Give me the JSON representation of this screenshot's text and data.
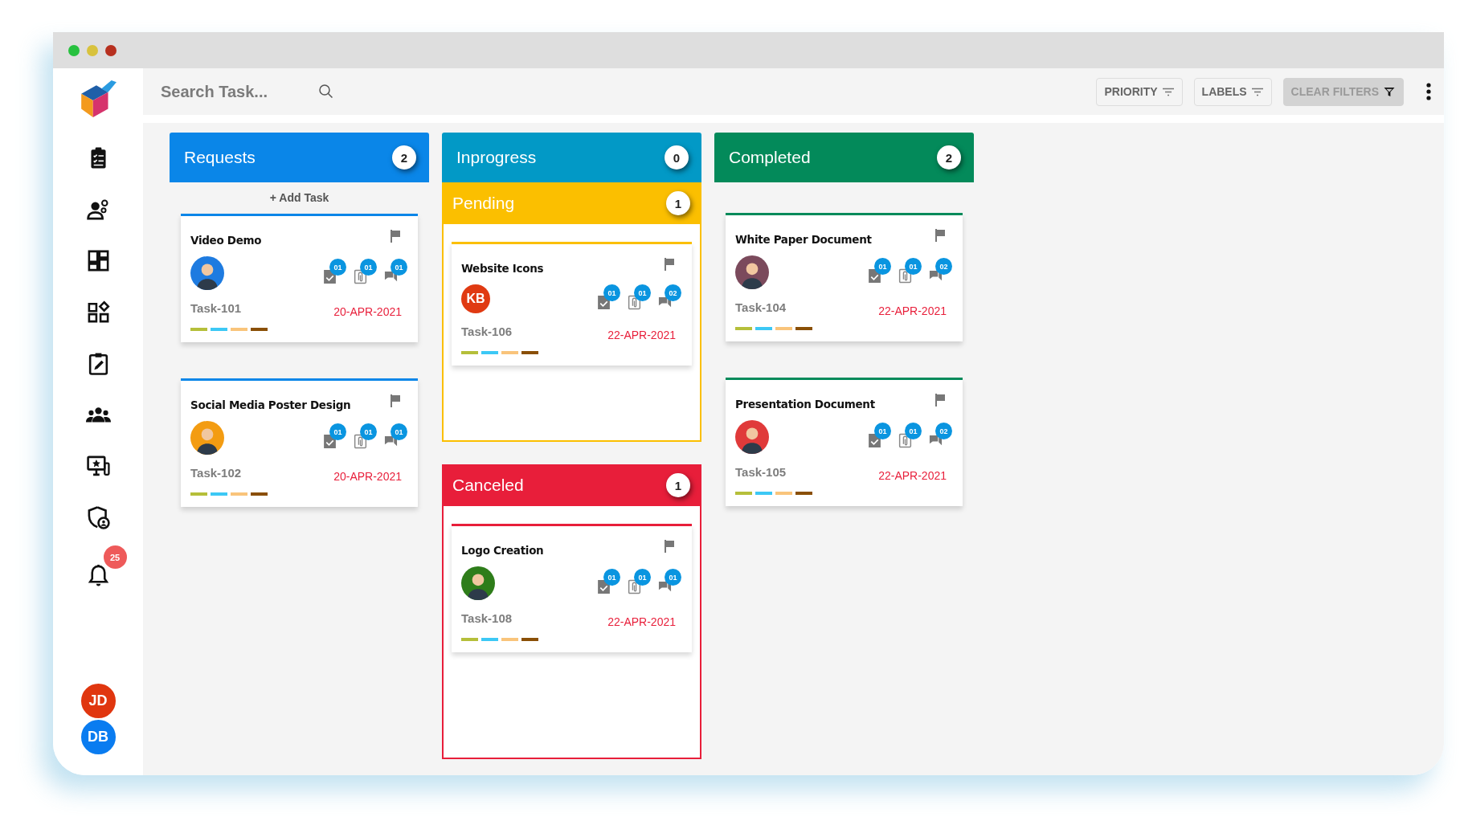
{
  "search": {
    "placeholder": "Search Task..."
  },
  "filters": [
    {
      "label": "PRIORITY",
      "kind": "sort",
      "disabled": false
    },
    {
      "label": "LABELS",
      "kind": "sort",
      "disabled": false
    },
    {
      "label": "CLEAR FILTERS",
      "kind": "funnel",
      "disabled": true
    }
  ],
  "notifications": {
    "count": "25"
  },
  "users": [
    {
      "initials": "JD",
      "color": "#e0360f"
    },
    {
      "initials": "DB",
      "color": "#0a7cf0"
    }
  ],
  "lanes": [
    {
      "title": "Requests",
      "count": "2",
      "color": "#0a86e8",
      "add_task": "+ Add Task",
      "cards": [
        {
          "title": "Video Demo",
          "avatar": {
            "kind": "photo",
            "color": "#1e7be0"
          },
          "checklist": "01",
          "attachments": "01",
          "comments": "01",
          "task_id": "Task-101",
          "date": "20-APR-2021",
          "labels": [
            {
              "color": "#b5bf3a"
            },
            {
              "color": "#3cc8f5"
            },
            {
              "color": "#f9c47b"
            },
            {
              "color": "#8a4f06"
            }
          ]
        },
        {
          "title": "Social Media Poster Design",
          "avatar": {
            "kind": "photo",
            "color": "#f39c12"
          },
          "checklist": "01",
          "attachments": "01",
          "comments": "01",
          "task_id": "Task-102",
          "date": "20-APR-2021",
          "labels": [
            {
              "color": "#b5bf3a"
            },
            {
              "color": "#3cc8f5"
            },
            {
              "color": "#f9c47b"
            },
            {
              "color": "#8a4f06"
            }
          ]
        }
      ]
    },
    {
      "title": "Inprogress",
      "count": "0",
      "color": "#0299c6",
      "sublanes": [
        {
          "title": "Pending",
          "count": "1",
          "color": "#fbbf00",
          "cards": [
            {
              "title": "Website Icons",
              "avatar": {
                "kind": "initials",
                "initials": "KB",
                "color": "#e03a12"
              },
              "checklist": "01",
              "attachments": "01",
              "comments": "02",
              "task_id": "Task-106",
              "date": "22-APR-2021",
              "labels": [
                {
                  "color": "#b5bf3a"
                },
                {
                  "color": "#3cc8f5"
                },
                {
                  "color": "#f9c47b"
                },
                {
                  "color": "#8a4f06"
                }
              ]
            }
          ]
        },
        {
          "title": "Canceled",
          "count": "1",
          "color": "#e81e3a",
          "cards": [
            {
              "title": "Logo Creation",
              "avatar": {
                "kind": "photo",
                "color": "#2e7d1a"
              },
              "checklist": "01",
              "attachments": "01",
              "comments": "01",
              "task_id": "Task-108",
              "date": "22-APR-2021",
              "labels": [
                {
                  "color": "#b5bf3a"
                },
                {
                  "color": "#3cc8f5"
                },
                {
                  "color": "#f9c47b"
                },
                {
                  "color": "#8a4f06"
                }
              ]
            }
          ]
        }
      ]
    },
    {
      "title": "Completed",
      "count": "2",
      "color": "#038a5a",
      "cards": [
        {
          "title": "White Paper Document",
          "avatar": {
            "kind": "photo",
            "color": "#7b4a5c"
          },
          "checklist": "01",
          "attachments": "01",
          "comments": "02",
          "task_id": "Task-104",
          "date": "22-APR-2021",
          "labels": [
            {
              "color": "#b5bf3a"
            },
            {
              "color": "#3cc8f5"
            },
            {
              "color": "#f9c47b"
            },
            {
              "color": "#8a4f06"
            }
          ]
        },
        {
          "title": "Presentation Document",
          "avatar": {
            "kind": "photo",
            "color": "#e03a3a"
          },
          "checklist": "01",
          "attachments": "01",
          "comments": "02",
          "task_id": "Task-105",
          "date": "22-APR-2021",
          "labels": [
            {
              "color": "#b5bf3a"
            },
            {
              "color": "#3cc8f5"
            },
            {
              "color": "#f9c47b"
            },
            {
              "color": "#8a4f06"
            }
          ]
        }
      ]
    }
  ]
}
